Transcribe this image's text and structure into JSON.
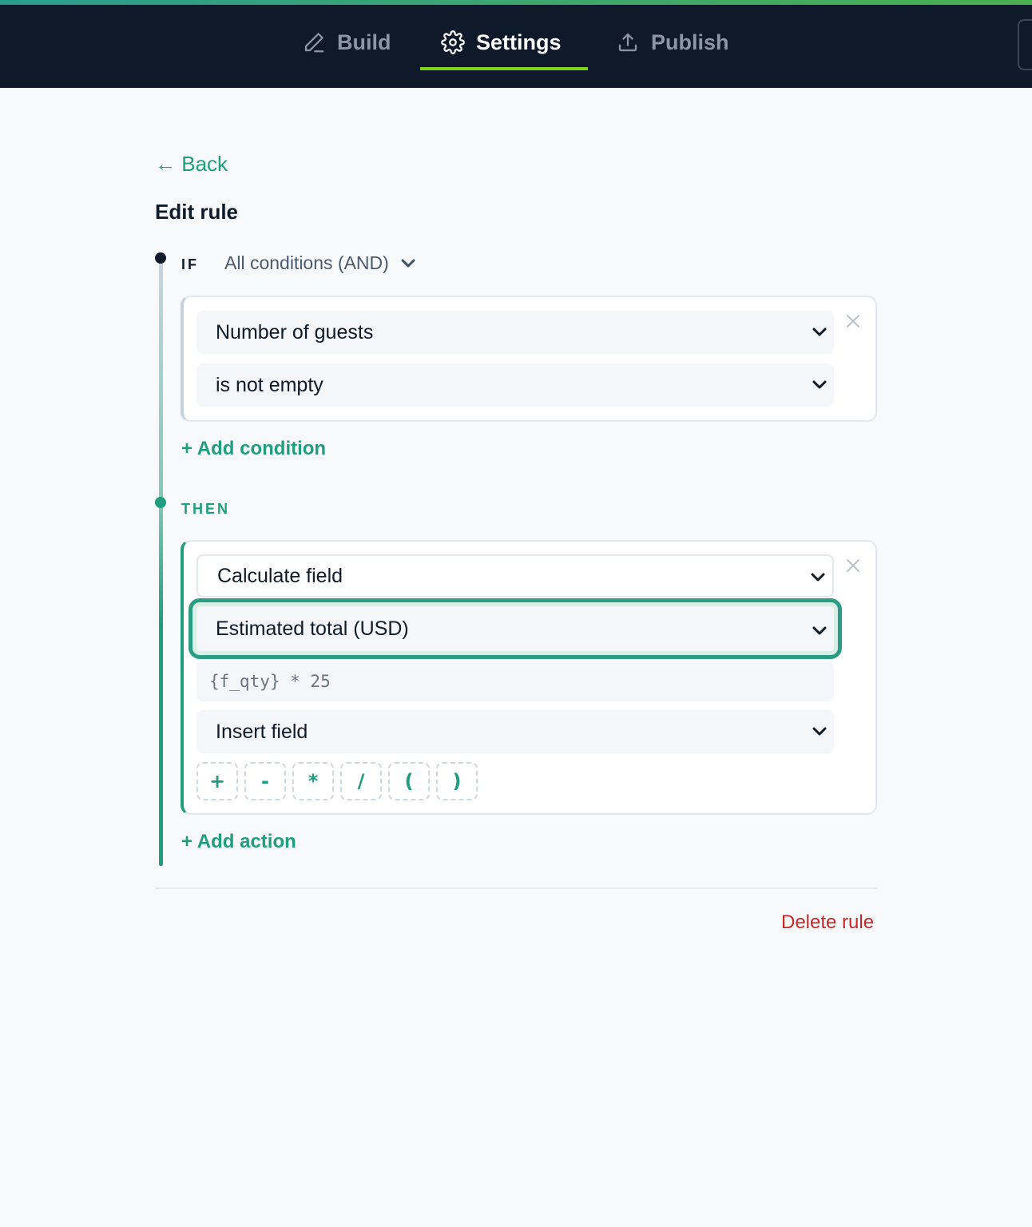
{
  "nav": {
    "tabs": [
      {
        "label": "Build",
        "icon": "pencil-icon"
      },
      {
        "label": "Settings",
        "icon": "gear-icon",
        "active": true
      },
      {
        "label": "Publish",
        "icon": "upload-icon"
      }
    ]
  },
  "back_label": "← Back",
  "page_title": "Edit rule",
  "if_section": {
    "label": "IF",
    "conjunction": "All conditions (AND)",
    "condition": {
      "field": "Number of guests",
      "operator": "is not empty"
    },
    "add_label": "+ Add condition"
  },
  "then_section": {
    "label": "THEN",
    "action": {
      "type": "Calculate field",
      "target": "Estimated total (USD)",
      "formula": "{f_qty} * 25",
      "insert_field": "Insert field",
      "operators": [
        "+",
        "-",
        "*",
        "/",
        "(",
        ")"
      ]
    },
    "add_label": "+ Add action"
  },
  "delete_label": "Delete rule",
  "colors": {
    "accent": "#1f9e7f",
    "nav_bg": "#0e1a2a",
    "active_tab_underline": "#7ed321",
    "danger": "#c62828"
  }
}
